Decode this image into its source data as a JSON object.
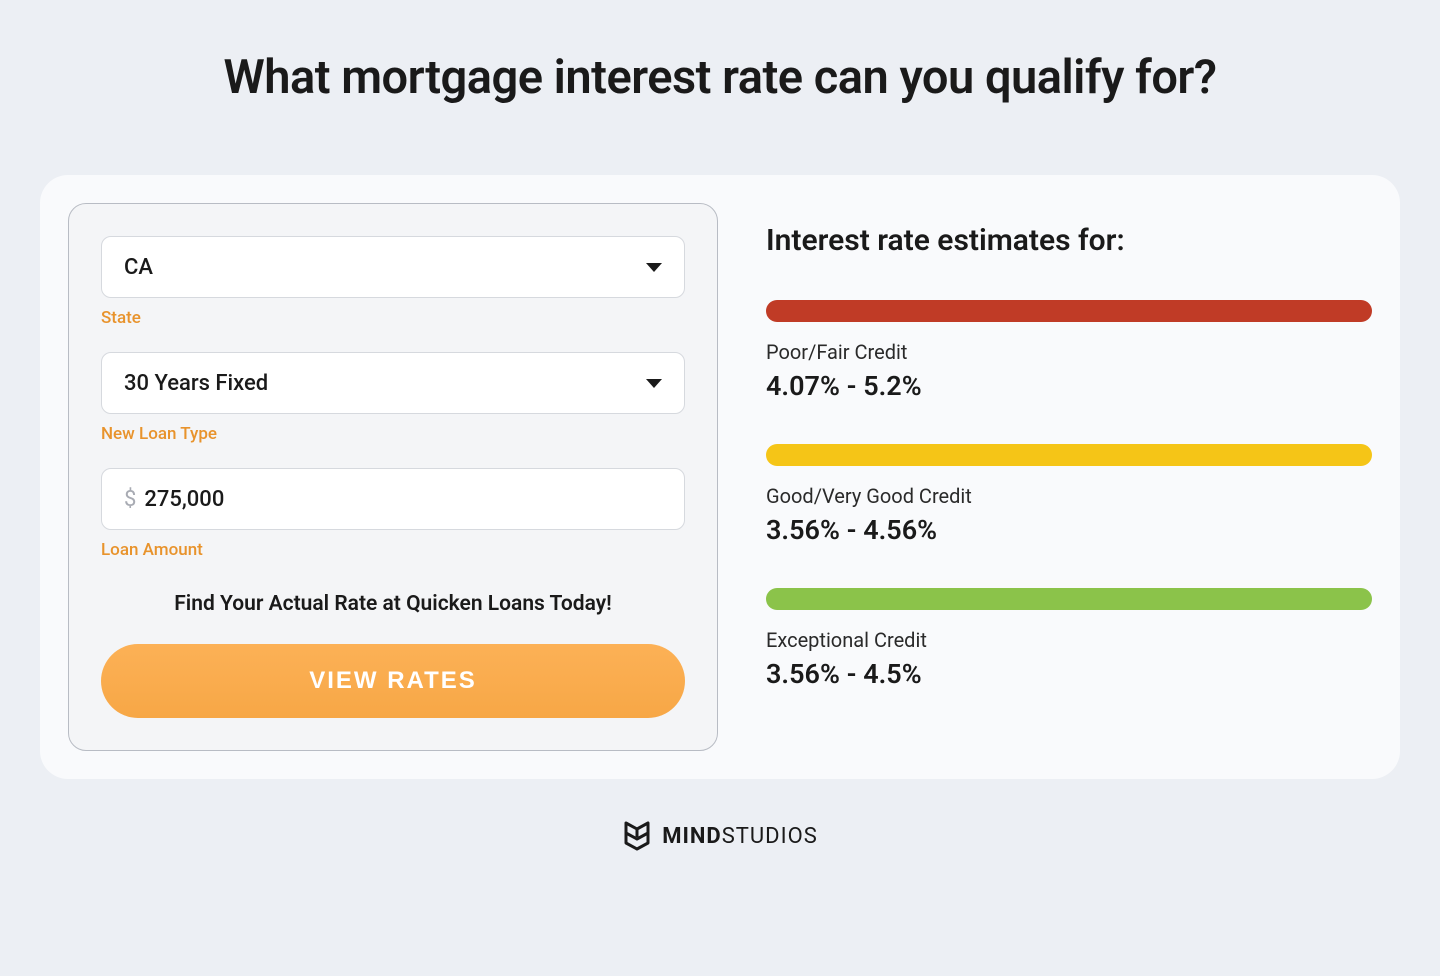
{
  "page": {
    "title": "What mortgage interest rate can you qualify for?"
  },
  "form": {
    "state": {
      "value": "CA",
      "label": "State"
    },
    "loan_type": {
      "value": "30 Years Fixed",
      "label": "New Loan Type"
    },
    "loan_amount": {
      "currency": "$",
      "value": "275,000",
      "label": "Loan Amount"
    },
    "cta_text": "Find Your Actual Rate at Quicken Loans Today!",
    "button": "VIEW RATES"
  },
  "estimates": {
    "title": "Interest rate estimates for:",
    "tiers": [
      {
        "label": "Poor/Fair Credit",
        "range": "4.07% - 5.2%"
      },
      {
        "label": "Good/Very Good Credit",
        "range": "3.56% - 4.56%"
      },
      {
        "label": "Exceptional Credit",
        "range": "3.56% - 4.5%"
      }
    ]
  },
  "footer": {
    "brand_bold": "MIND",
    "brand_light": "STUDIOS"
  }
}
